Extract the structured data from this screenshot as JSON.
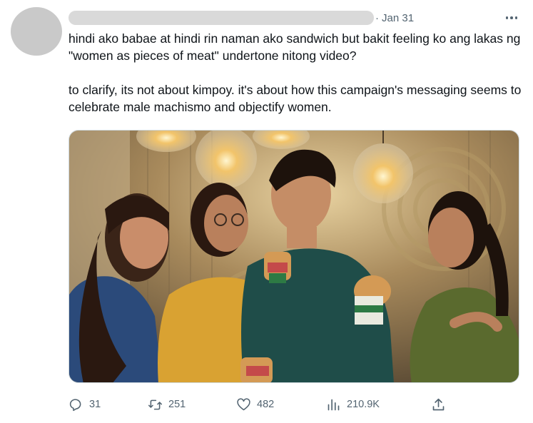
{
  "tweet": {
    "date": "Jan 31",
    "dot": "·",
    "paragraphs": [
      "hindi ako babae at hindi rin naman ako sandwich but bakit feeling ko ang lakas ng \"women as pieces of meat\" undertone nitong video?",
      "to clarify, its not about kimpoy. it's about how this campaign's messaging seems to celebrate male machismo and objectify women."
    ]
  },
  "metrics": {
    "replies": "31",
    "retweets": "251",
    "likes": "482",
    "views": "210.9K"
  },
  "icons": {
    "reply": "reply-icon",
    "retweet": "retweet-icon",
    "like": "heart-icon",
    "views": "views-icon",
    "share": "share-icon",
    "more": "more-icon"
  },
  "colors": {
    "text": "#0f1419",
    "secondary": "#536471",
    "redaction": "#d9d9d9",
    "avatar": "#c9c9c9"
  }
}
